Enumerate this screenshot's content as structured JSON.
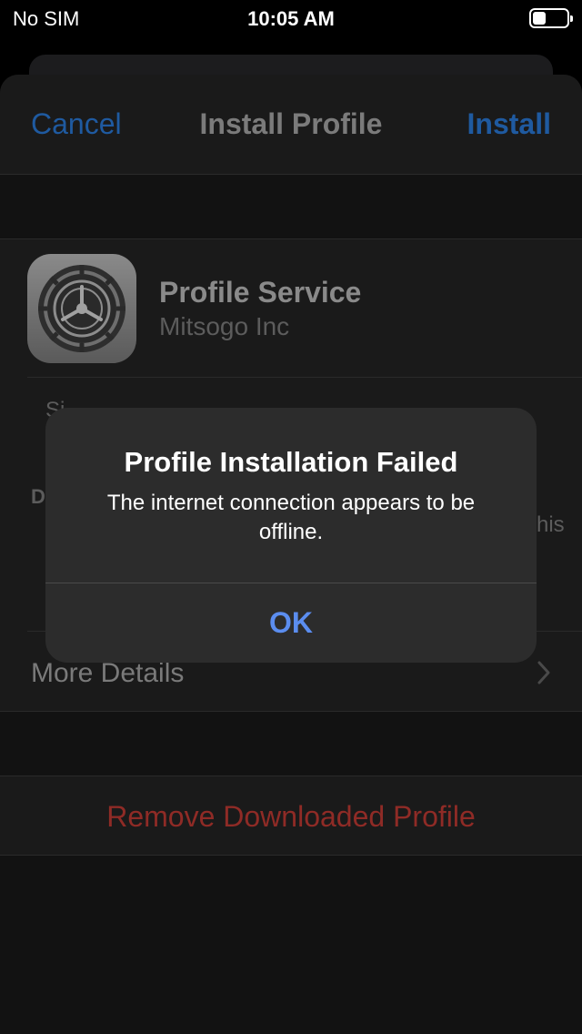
{
  "status_bar": {
    "carrier": "No SIM",
    "time": "10:05 AM",
    "battery_level": 0.4
  },
  "nav": {
    "cancel_label": "Cancel",
    "title": "Install Profile",
    "install_label": "Install"
  },
  "profile": {
    "icon": "settings-gear-icon",
    "name": "Profile Service",
    "organization": "Mitsogo Inc",
    "signed_partial": "Si...",
    "description_partial": "D",
    "description_tail_partial": "his",
    "more_details_label": "More Details"
  },
  "actions": {
    "remove_label": "Remove Downloaded Profile"
  },
  "alert": {
    "title": "Profile Installation Failed",
    "message": "The internet connection appears to be offline.",
    "ok_label": "OK"
  },
  "colors": {
    "link_blue": "#1f5aa0",
    "alert_button_blue": "#5b8def",
    "destructive_red": "#8f2b26",
    "alert_bg": "#2c2c2c"
  }
}
